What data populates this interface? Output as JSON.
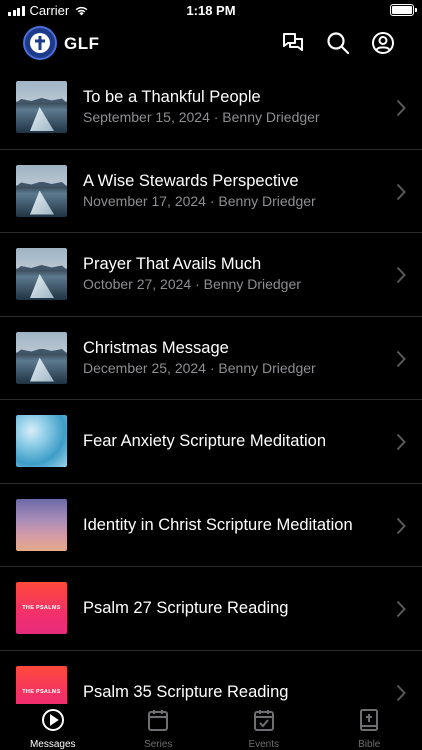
{
  "status_bar": {
    "carrier": "Carrier",
    "time": "1:18 PM"
  },
  "header": {
    "title": "GLF",
    "icons": [
      "chat-bubbles-icon",
      "search-icon",
      "account-icon"
    ]
  },
  "messages": [
    {
      "title": "To be a Thankful People",
      "meta": "September 15, 2024 · Benny Driedger",
      "thumbnail": "sea-ice"
    },
    {
      "title": "A Wise Stewards Perspective",
      "meta": "November 17, 2024 · Benny Driedger",
      "thumbnail": "sea-ice"
    },
    {
      "title": "Prayer That Avails Much",
      "meta": "October 27, 2024 · Benny Driedger",
      "thumbnail": "sea-ice"
    },
    {
      "title": "Christmas Message",
      "meta": "December 25, 2024 · Benny Driedger",
      "thumbnail": "sea-ice"
    },
    {
      "title": "Fear Anxiety Scripture Meditation",
      "meta": "",
      "thumbnail": "water"
    },
    {
      "title": "Identity in Christ Scripture Meditation",
      "meta": "",
      "thumbnail": "sky"
    },
    {
      "title": "Psalm 27 Scripture Reading",
      "meta": "",
      "thumbnail": "psalms",
      "thumb_text": "THE PSALMS"
    },
    {
      "title": "Psalm 35 Scripture Reading",
      "meta": "",
      "thumbnail": "psalms",
      "thumb_text": "THE PSALMS"
    }
  ],
  "tabs": [
    {
      "label": "Messages",
      "icon": "play-circle-icon",
      "active": true
    },
    {
      "label": "Series",
      "icon": "calendar-icon",
      "active": false
    },
    {
      "label": "Events",
      "icon": "calendar-check-icon",
      "active": false
    },
    {
      "label": "Bible",
      "icon": "bible-cross-icon",
      "active": false
    }
  ],
  "colors": {
    "background": "#000000",
    "secondary_text": "#8e8e93",
    "tab_inactive": "#6e6e73",
    "logo_blue": "#1e3a8a"
  }
}
